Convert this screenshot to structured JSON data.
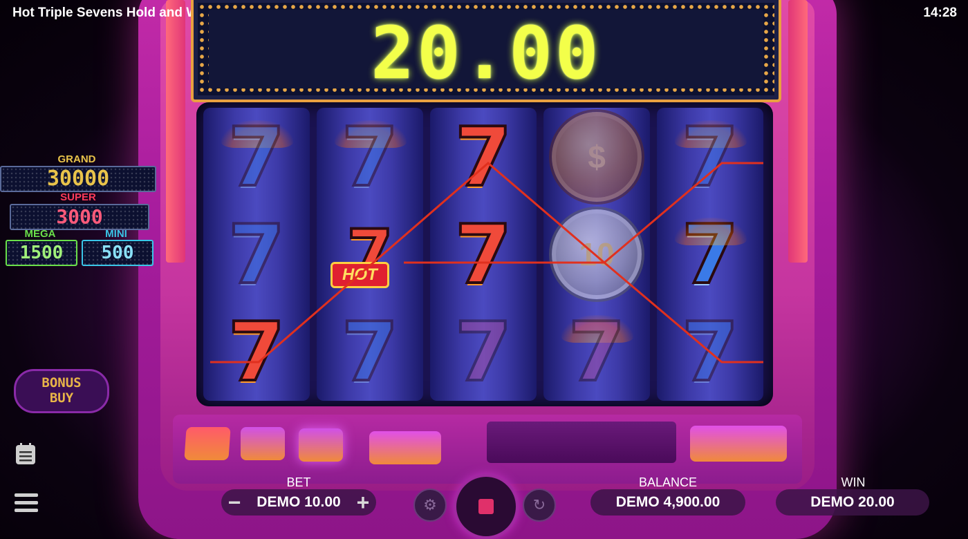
{
  "header": {
    "title": "Hot Triple Sevens Hold and Win",
    "clock": "14:28"
  },
  "display": {
    "win_amount": "20.00"
  },
  "jackpots": {
    "grand": {
      "label": "GRAND",
      "value": "30000",
      "color": "#e9c34a"
    },
    "super": {
      "label": "SUPER",
      "value": "3000",
      "color": "#ff3b5a"
    },
    "mega": {
      "label": "MEGA",
      "value": "1500",
      "color": "#6ae04a"
    },
    "mini": {
      "label": "MINI",
      "value": "500",
      "color": "#3ac6e8"
    }
  },
  "bonus_buy": {
    "line1": "BONUS",
    "line2": "BUY"
  },
  "reels": [
    [
      "seven-blue",
      "seven-blue",
      "seven-red"
    ],
    [
      "seven-blue",
      "hot-seven",
      "seven-blue"
    ],
    [
      "seven-red",
      "seven-red",
      "seven-purple"
    ],
    [
      "dollar-coin",
      "coin-10",
      "seven-purple"
    ],
    [
      "seven-blue",
      "seven-blue",
      "seven-blue"
    ]
  ],
  "symbols": {
    "hot_badge": "HOT",
    "coin_dollar": "$",
    "coin_value": "10",
    "seven": "7"
  },
  "bottom": {
    "bet_label": "BET",
    "bet_value": "DEMO 10.00",
    "minus": "−",
    "plus": "+",
    "balance_label": "BALANCE",
    "balance_value": "DEMO 4,900.00",
    "win_label": "WIN",
    "win_value": "DEMO 20.00"
  },
  "icons": {
    "menu": "hamburger-menu-icon",
    "paytable": "paytable-icon",
    "autoplay": "autoplay-icon",
    "turbo": "turbo-spin-icon",
    "stop": "stop-icon"
  },
  "colors": {
    "payline": "#e0301e",
    "accent": "#c030c0",
    "win_digits": "#f3ff4a"
  }
}
